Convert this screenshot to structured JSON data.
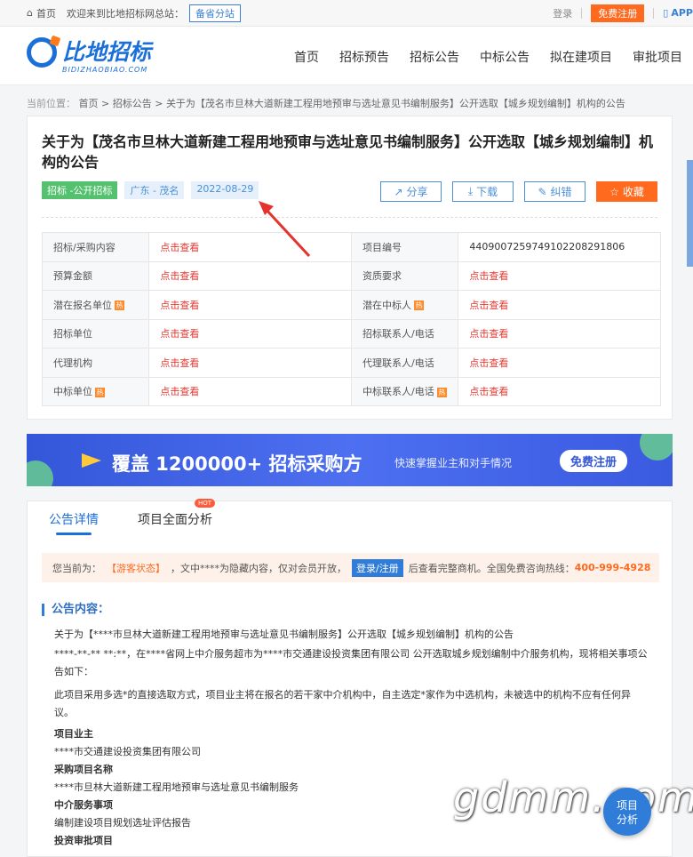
{
  "topbar": {
    "home": "首页",
    "welcome": "欢迎来到比地招标网总站：",
    "branch": "备省分站",
    "login": "登录",
    "register": "免费注册",
    "app": "APP"
  },
  "logo": {
    "name": "比地招标",
    "sub": "BIDIZHAOBIAO.COM"
  },
  "nav": [
    "首页",
    "招标预告",
    "招标公告",
    "中标公告",
    "拟在建项目",
    "审批项目"
  ],
  "breadcrumb": {
    "prefix": "当前位置：",
    "home": "首页",
    "cat": "招标公告",
    "current": "关于为【茂名市旦林大道新建工程用地预审与选址意见书编制服务】公开选取【城乡规划编制】机构的公告"
  },
  "title": "关于为【茂名市旦林大道新建工程用地预审与选址意见书编制服务】公开选取【城乡规划编制】机构的公告",
  "tags": {
    "type": "招标 -公开招标",
    "region": "广东 - 茂名",
    "date": "2022-08-29"
  },
  "actions": {
    "share": "分享",
    "download": "下载",
    "correct": "纠错",
    "fav": "收藏"
  },
  "info": {
    "click": "点击查看",
    "rows": [
      {
        "l1": "招标/采购内容",
        "l2": "项目编号",
        "v2": "440900725974910220829180​6"
      },
      {
        "l1": "预算金额",
        "l2": "资质要求"
      },
      {
        "l1": "潜在报名单位",
        "l2": "潜在中标人"
      },
      {
        "l1": "招标单位",
        "l2": "招标联系人/电话"
      },
      {
        "l1": "代理机构",
        "l2": "代理联系人/电话"
      },
      {
        "l1": "中标单位",
        "l2": "中标联系人/电话"
      }
    ]
  },
  "banner": {
    "big": "覆盖 1200000+ 招标采购方",
    "small": "快速掌握业主和对手情况",
    "btn": "免费注册"
  },
  "tabs": {
    "detail": "公告详情",
    "analysis": "项目全面分析",
    "hot": "HOT"
  },
  "notice": {
    "a": "您当前为：",
    "guest": "【游客状态】",
    "b": "，文中****为隐藏内容，仅对会员开放，",
    "login": "登录/注册",
    "c": "后查看完整商机。全国免费咨询热线：",
    "phone": "400-999-4928"
  },
  "section": "公告内容：",
  "body": [
    "关于为【****市旦林大道新建工程用地预审与选址意见书编制服务】公开选取【城乡规划编制】机构的公告",
    "****-**-** **:**，在****省网上中介服务超市为****市交通建设投资集团有限公司 公开选取城乡规划编制中介服务机构，现将相关事项公告如下：",
    "此项目采用多选*的直接选取方式，项目业主将在报名的若干家中介机构中，自主选定*家作为中选机构，未被选中的机构不应有任何异议。",
    "项目业主",
    "****市交通建设投资集团有限公司",
    "采购项目名称",
    "****市旦林大道新建工程用地预审与选址意见书编制服务",
    "中介服务事项",
    "编制建设项目规划选址评估报告",
    "投资审批项目"
  ],
  "watermark": "gdmm.com",
  "float": {
    "a": "项目",
    "b": "分析"
  }
}
